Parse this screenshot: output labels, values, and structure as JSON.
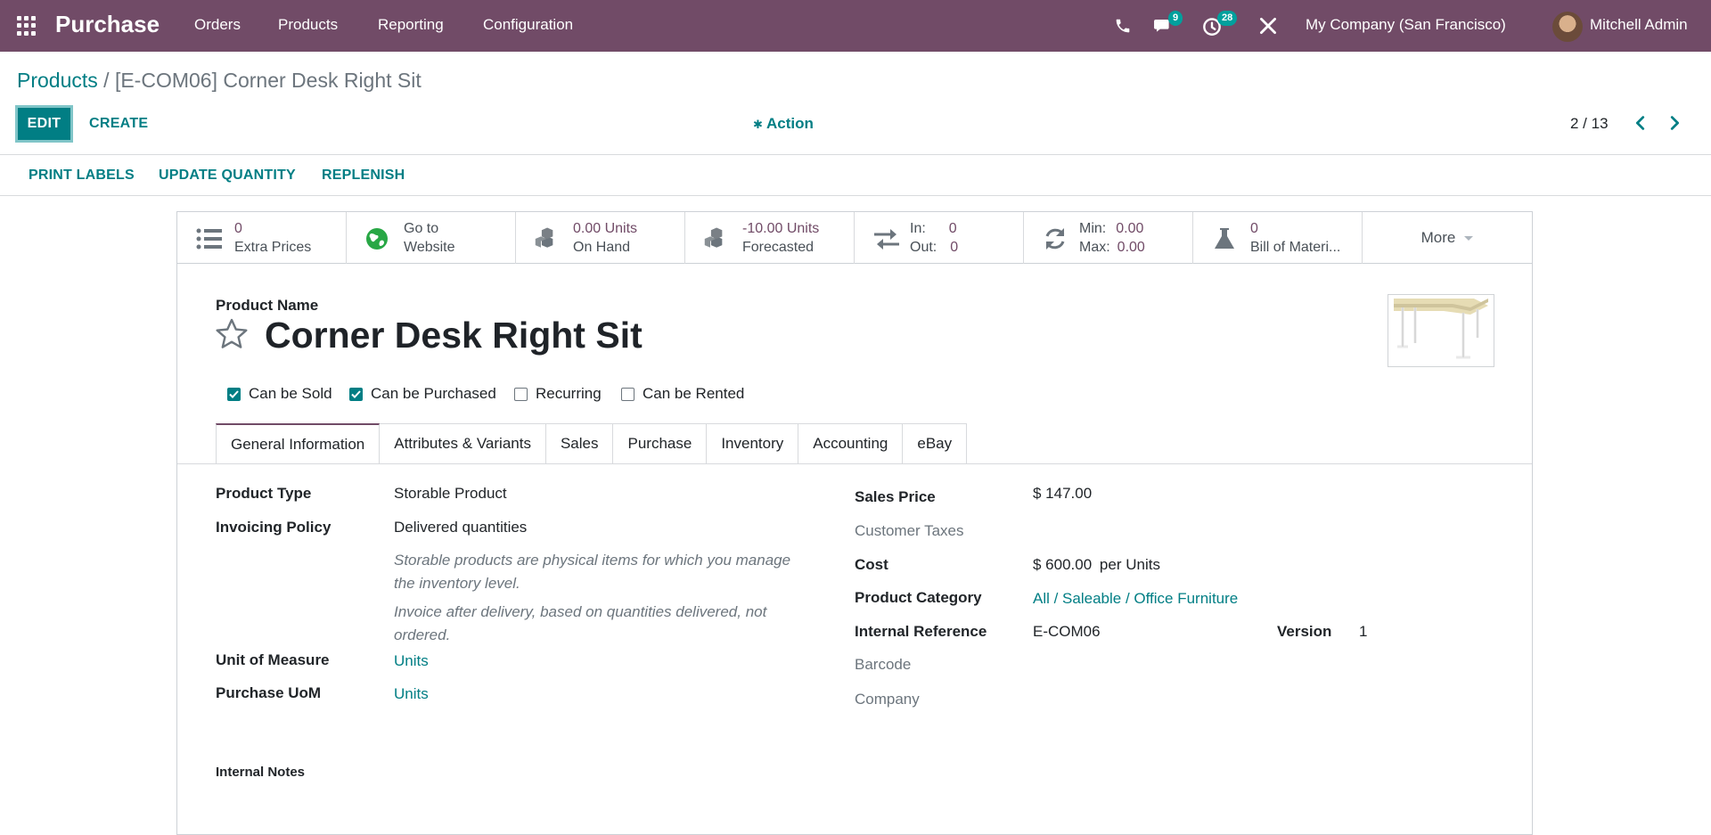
{
  "navbar": {
    "app_name": "Purchase",
    "menus": [
      "Orders",
      "Products",
      "Reporting",
      "Configuration"
    ],
    "messages_count": "9",
    "activities_count": "28",
    "company": "My Company (San Francisco)",
    "user": "Mitchell Admin",
    "bg_color": "#714b67"
  },
  "breadcrumb": {
    "parent": "Products",
    "separator": "/",
    "current": "[E-COM06] Corner Desk Right Sit"
  },
  "toolbar": {
    "edit_label": "EDIT",
    "create_label": "CREATE",
    "action_label": "Action",
    "pager": "2 / 13"
  },
  "status_buttons": [
    "PRINT LABELS",
    "UPDATE QUANTITY",
    "REPLENISH"
  ],
  "stats": {
    "extra_prices": {
      "value": "0",
      "label": "Extra Prices"
    },
    "website": {
      "line1": "Go to",
      "line2": "Website"
    },
    "on_hand": {
      "value": "0.00 Units",
      "label": "On Hand"
    },
    "forecasted": {
      "value": "-10.00 Units",
      "label": "Forecasted"
    },
    "in_out": {
      "in_label": "In:",
      "in_value": "0",
      "out_label": "Out:",
      "out_value": "0"
    },
    "min_max": {
      "min_label": "Min:",
      "min_value": "0.00",
      "max_label": "Max:",
      "max_value": "0.00"
    },
    "bom": {
      "value": "0",
      "label": "Bill of Materi..."
    },
    "more_label": "More"
  },
  "product": {
    "name_label": "Product Name",
    "name": "Corner Desk Right Sit"
  },
  "checkboxes": [
    {
      "label": "Can be Sold",
      "checked": true
    },
    {
      "label": "Can be Purchased",
      "checked": true
    },
    {
      "label": "Recurring",
      "checked": false
    },
    {
      "label": "Can be Rented",
      "checked": false
    }
  ],
  "tabs": [
    "General Information",
    "Attributes & Variants",
    "Sales",
    "Purchase",
    "Inventory",
    "Accounting",
    "eBay"
  ],
  "left_fields": {
    "product_type_label": "Product Type",
    "product_type": "Storable Product",
    "invoicing_policy_label": "Invoicing Policy",
    "invoicing_policy": "Delivered quantities",
    "help1": "Storable products are physical items for which you manage the inventory level.",
    "help2": "Invoice after delivery, based on quantities delivered, not ordered.",
    "uom_label": "Unit of Measure",
    "uom": "Units",
    "purchase_uom_label": "Purchase UoM",
    "purchase_uom": "Units"
  },
  "right_fields": {
    "sales_price_label": "Sales Price",
    "sales_price": "$ 147.00",
    "customer_taxes_label": "Customer Taxes",
    "cost_label": "Cost",
    "cost": "$ 600.00",
    "cost_suffix": "per Units",
    "category_label": "Product Category",
    "category": "All / Saleable / Office Furniture",
    "internal_ref_label": "Internal Reference",
    "internal_ref": "E-COM06",
    "version_label": "Version",
    "version": "1",
    "barcode_label": "Barcode",
    "company_label": "Company"
  },
  "notes_label": "Internal Notes"
}
